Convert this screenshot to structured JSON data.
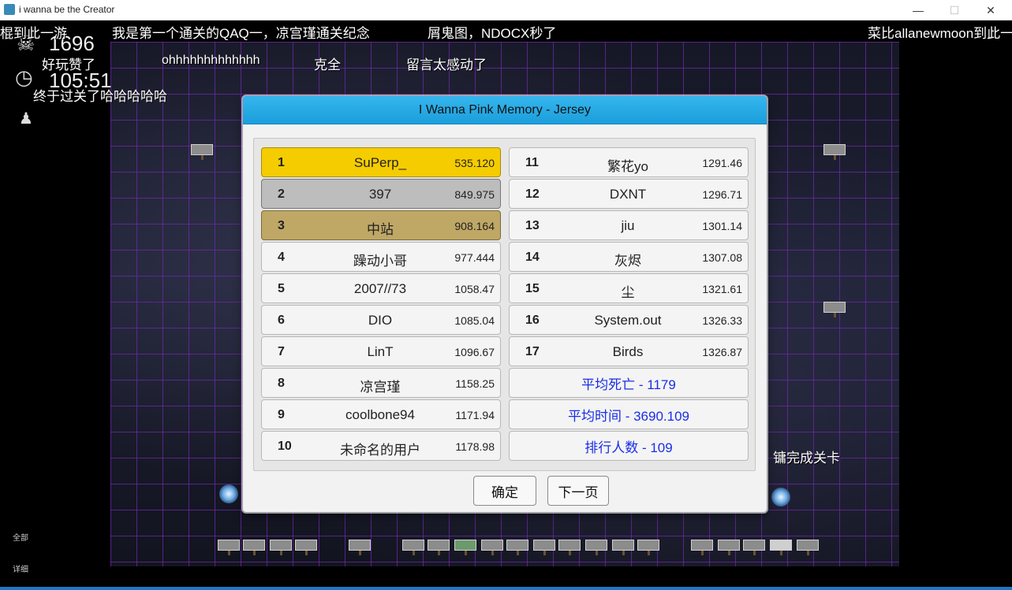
{
  "window": {
    "title": "i wanna be the Creator",
    "minimize_glyph": "—",
    "maximize_glyph": "☐",
    "close_glyph": "✕"
  },
  "hud": {
    "deaths": "1696",
    "time": "105:51",
    "death_icon": "skull-icon",
    "clock_icon": "clock-icon",
    "label_all": "全部",
    "label_detail": "详细"
  },
  "danmaku": [
    "棍到此一游",
    "我是第一个通关的QAQ一，凉宫瑾通关纪念",
    "屑鬼图，NDOCX秒了",
    "菜比allanewmoon到此一",
    "好玩赞了",
    "ohhhhhhhhhhhhh",
    "克全",
    "留言太感动了",
    "终于过关了哈哈哈哈哈",
    "镛完成关卡"
  ],
  "dialog": {
    "title": "I Wanna Pink Memory - Jersey",
    "leaderboard": [
      {
        "rank": "1",
        "name": "SuPerp_",
        "time": "535.120"
      },
      {
        "rank": "2",
        "name": "397",
        "time": "849.975"
      },
      {
        "rank": "3",
        "name": "中站",
        "time": "908.164"
      },
      {
        "rank": "4",
        "name": "躁动小哥",
        "time": "977.444"
      },
      {
        "rank": "5",
        "name": "2007//73",
        "time": "1058.47"
      },
      {
        "rank": "6",
        "name": "DIO",
        "time": "1085.04"
      },
      {
        "rank": "7",
        "name": "LinT",
        "time": "1096.67"
      },
      {
        "rank": "8",
        "name": "凉宫瑾",
        "time": "1158.25"
      },
      {
        "rank": "9",
        "name": "coolbone94",
        "time": "1171.94"
      },
      {
        "rank": "10",
        "name": "未命名的用户",
        "time": "1178.98"
      },
      {
        "rank": "11",
        "name": "繁花yo",
        "time": "1291.46"
      },
      {
        "rank": "12",
        "name": "DXNT",
        "time": "1296.71"
      },
      {
        "rank": "13",
        "name": "jiu",
        "time": "1301.14"
      },
      {
        "rank": "14",
        "name": "灰烬",
        "time": "1307.08"
      },
      {
        "rank": "15",
        "name": "尘",
        "time": "1321.61"
      },
      {
        "rank": "16",
        "name": "System.out",
        "time": "1326.33"
      },
      {
        "rank": "17",
        "name": "Birds",
        "time": "1326.87"
      }
    ],
    "stats": {
      "avg_deaths": "平均死亡 - 1179",
      "avg_time": "平均时间 - 3690.109",
      "player_count": "排行人数 - 109"
    },
    "ok_label": "确定",
    "next_label": "下一页"
  },
  "colors": {
    "title_bar": "#1b9edb",
    "gold": "#f5cc00",
    "silver": "#bdbdbd",
    "bronze": "#bfa765",
    "stat_text": "#1a2ee6",
    "grid": "#6e28aa"
  }
}
